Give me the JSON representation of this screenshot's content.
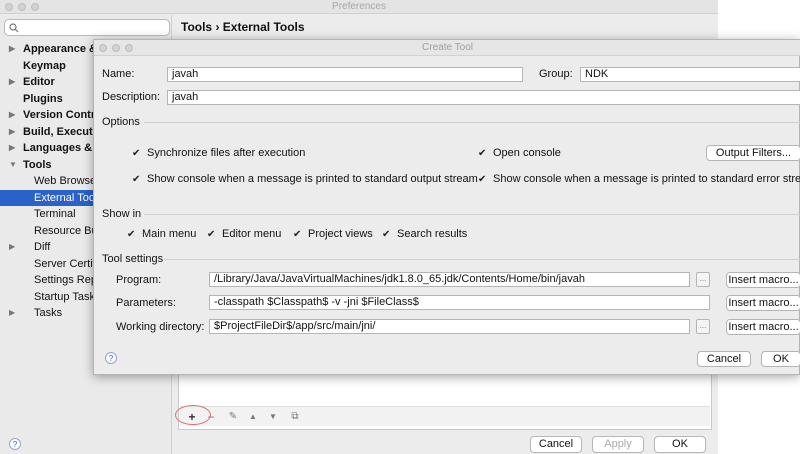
{
  "preferences": {
    "window_title": "Preferences",
    "header": "Tools › External Tools",
    "sidebar": [
      {
        "label": "Appearance &",
        "arrow": "▶",
        "bold": true
      },
      {
        "label": "Keymap",
        "arrow": "",
        "bold": true
      },
      {
        "label": "Editor",
        "arrow": "▶",
        "bold": true
      },
      {
        "label": "Plugins",
        "arrow": "",
        "bold": true
      },
      {
        "label": "Version Contr",
        "arrow": "▶",
        "bold": true
      },
      {
        "label": "Build, Executio",
        "arrow": "▶",
        "bold": true
      },
      {
        "label": "Languages & F",
        "arrow": "▶",
        "bold": true
      },
      {
        "label": "Tools",
        "arrow": "▼",
        "bold": true
      },
      {
        "label": "Web Browser",
        "arrow": "",
        "bold": false
      },
      {
        "label": "External Too",
        "arrow": "",
        "bold": false,
        "selected": true
      },
      {
        "label": "Terminal",
        "arrow": "",
        "bold": false
      },
      {
        "label": "Resource Bu",
        "arrow": "",
        "bold": false
      },
      {
        "label": "Diff",
        "arrow": "▶",
        "bold": false
      },
      {
        "label": "Server Certif",
        "arrow": "",
        "bold": false
      },
      {
        "label": "Settings Rep",
        "arrow": "",
        "bold": false
      },
      {
        "label": "Startup Task",
        "arrow": "",
        "bold": false
      },
      {
        "label": "Tasks",
        "arrow": "▶",
        "bold": false
      }
    ],
    "toolbar": {
      "add": "+",
      "remove": "−",
      "edit": "✎",
      "up": "▲",
      "down": "▼",
      "copy": "⧉"
    },
    "buttons": {
      "cancel": "Cancel",
      "apply": "Apply",
      "ok": "OK"
    },
    "help": "?"
  },
  "dialog": {
    "title": "Create Tool",
    "name_label": "Name:",
    "name_value": "javah",
    "group_label": "Group:",
    "group_value": "NDK",
    "description_label": "Description:",
    "description_value": "javah",
    "options_label": "Options",
    "options": {
      "sync_files": {
        "label": "Synchronize files after execution",
        "checked": true
      },
      "open_console": {
        "label": "Open console",
        "checked": true
      },
      "console_stdout": {
        "label": "Show console when a message is printed to standard output stream",
        "checked": true
      },
      "console_stderr": {
        "label": "Show console when a message is printed to standard error stream",
        "checked": true
      }
    },
    "output_filters_button": "Output Filters...",
    "show_in_label": "Show in",
    "show_in": {
      "main_menu": {
        "label": "Main menu",
        "checked": true
      },
      "editor_menu": {
        "label": "Editor menu",
        "checked": true
      },
      "project_views": {
        "label": "Project views",
        "checked": true
      },
      "search_results": {
        "label": "Search results",
        "checked": true
      }
    },
    "tool_settings_label": "Tool settings",
    "program_label": "Program:",
    "program_value": "/Library/Java/JavaVirtualMachines/jdk1.8.0_65.jdk/Contents/Home/bin/javah",
    "parameters_label": "Parameters:",
    "parameters_value": "-classpath $Classpath$ -v -jni $FileClass$",
    "working_dir_label": "Working directory:",
    "working_dir_value": "$ProjectFileDir$/app/src/main/jni/",
    "browse_label": "...",
    "insert_macro_label": "Insert macro...",
    "cancel_label": "Cancel",
    "ok_label": "OK",
    "help": "?",
    "check_mark": "✔"
  }
}
